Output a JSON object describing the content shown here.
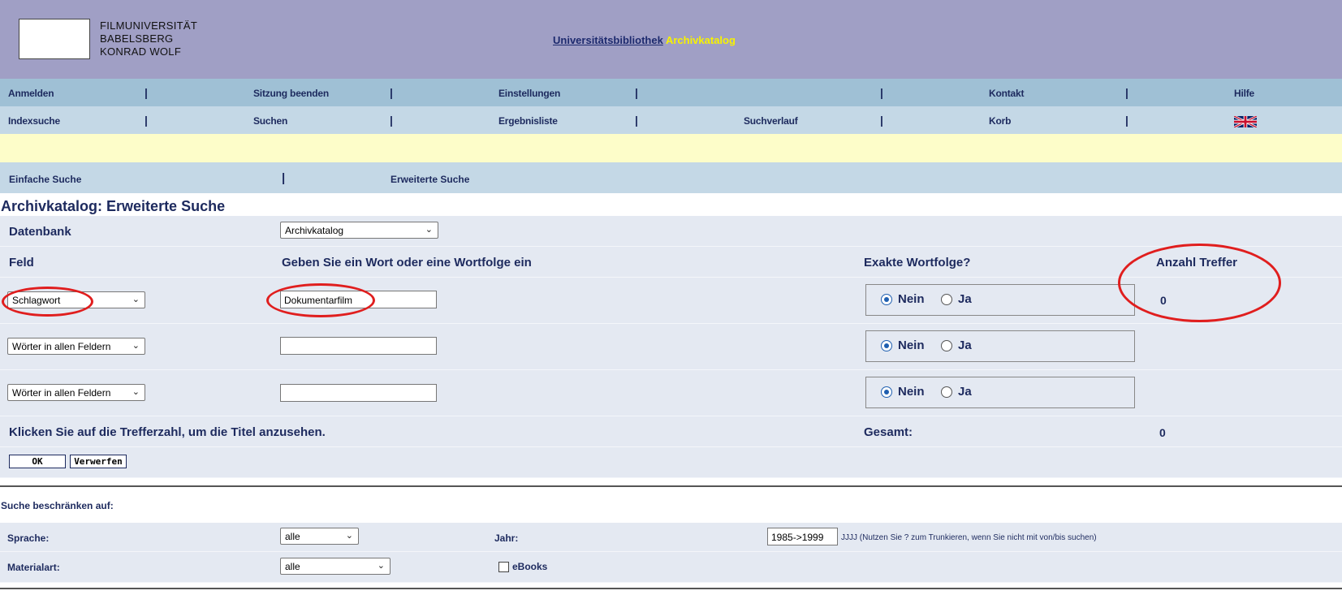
{
  "header": {
    "logo_lines": [
      "FILMUNIVERSITÄT",
      "BABELSBERG",
      "KONRAD WOLF"
    ],
    "title_link": "Universitätsbibliothek",
    "title_accent": "Archivkatalog"
  },
  "nav1": {
    "items": [
      "Anmelden",
      "Sitzung beenden",
      "Einstellungen",
      "",
      "Kontakt",
      "Hilfe"
    ],
    "sep": "|"
  },
  "nav2": {
    "items": [
      "Indexsuche",
      "Suchen",
      "Ergebnisliste",
      "Suchverlauf",
      "Korb"
    ],
    "flag_icon": "uk-flag-icon"
  },
  "tabs": {
    "simple": "Einfache Suche",
    "advanced": "Erweiterte Suche"
  },
  "page_title": "Archivkatalog: Erweiterte Suche",
  "database": {
    "label": "Datenbank",
    "selected": "Archivkatalog"
  },
  "columns": {
    "field": "Feld",
    "query": "Geben Sie ein Wort oder eine Wortfolge ein",
    "exact": "Exakte Wortfolge?",
    "hits": "Anzahl Treffer"
  },
  "search_rows": [
    {
      "field": "Schlagwort",
      "value": "Dokumentarfilm",
      "no": "Nein",
      "yes": "Ja",
      "hits": "0"
    },
    {
      "field": "Wörter in allen Feldern",
      "value": "",
      "no": "Nein",
      "yes": "Ja",
      "hits": ""
    },
    {
      "field": "Wörter in allen Feldern",
      "value": "",
      "no": "Nein",
      "yes": "Ja",
      "hits": ""
    }
  ],
  "summary": {
    "hint": "Klicken Sie auf die Trefferzahl, um die Titel anzusehen.",
    "total_label": "Gesamt:",
    "total_value": "0"
  },
  "buttons": {
    "ok": "OK",
    "reset": "Verwerfen"
  },
  "limits": {
    "heading": "Suche beschränken auf:",
    "language_label": "Sprache:",
    "language_value": "alle",
    "year_label": "Jahr:",
    "year_value": "1985->1999",
    "year_hint": "JJJJ (Nutzen Sie ? zum Trunkieren, wenn Sie nicht mit von/bis suchen)",
    "material_label": "Materialart:",
    "material_value": "alle",
    "ebooks_label": "eBooks"
  },
  "colors": {
    "header_bg": "#a09fc5",
    "nav1_bg": "#9fc0d5",
    "nav2_bg": "#c4d8e6",
    "highlight_bar": "#fdfdc9",
    "form_bg": "#e4e9f2",
    "text": "#1d2a5e",
    "accent_yellow": "#f7f200",
    "annotation_red": "#e01e1e"
  }
}
